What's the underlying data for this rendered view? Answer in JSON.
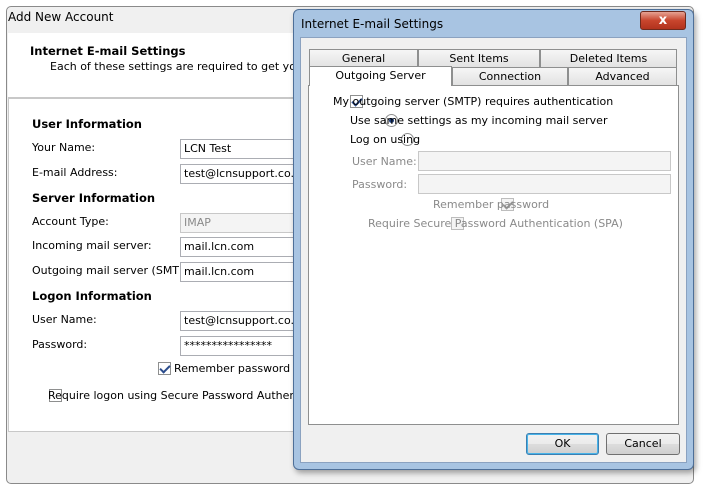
{
  "background_window": {
    "title": "Add New Account",
    "header": {
      "title": "Internet E-mail Settings",
      "description": "Each of these settings are required to get your e"
    },
    "user_information": {
      "heading": "User Information",
      "your_name_label": "Your Name:",
      "your_name_value": "LCN Test",
      "email_label": "E-mail Address:",
      "email_value": "test@lcnsupport.co.uk"
    },
    "server_information": {
      "heading": "Server Information",
      "account_type_label": "Account Type:",
      "account_type_value": "IMAP",
      "incoming_label": "Incoming mail server:",
      "incoming_value": "mail.lcn.com",
      "outgoing_label": "Outgoing mail server (SMTP):",
      "outgoing_value": "mail.lcn.com"
    },
    "logon_information": {
      "heading": "Logon Information",
      "user_name_label": "User Name:",
      "user_name_value": "test@lcnsupport.co.uk",
      "password_label": "Password:",
      "password_value": "****************",
      "remember_password_label": "Remember password",
      "remember_password_checked": true,
      "spa_label": "Require logon using Secure Password Authenticatio",
      "spa_checked": false
    }
  },
  "dialog": {
    "title": "Internet E-mail Settings",
    "close_label": "x",
    "tabs_row1": [
      "General",
      "Sent Items",
      "Deleted Items"
    ],
    "tabs_row2": [
      "Outgoing Server",
      "Connection",
      "Advanced"
    ],
    "active_tab": "Outgoing Server",
    "outgoing": {
      "requires_auth_label": "My outgoing server (SMTP) requires authentication",
      "requires_auth_checked": true,
      "use_same_label": "Use same settings as my incoming mail server",
      "use_same_selected": true,
      "log_on_using_label": "Log on using",
      "log_on_using_selected": false,
      "user_name_label": "User Name:",
      "user_name_value": "",
      "password_label": "Password:",
      "password_value": "",
      "remember_password_label": "Remember password",
      "remember_password_checked": true,
      "spa_label": "Require Secure Password Authentication (SPA)",
      "spa_checked": false
    },
    "buttons": {
      "ok": "OK",
      "cancel": "Cancel"
    }
  }
}
